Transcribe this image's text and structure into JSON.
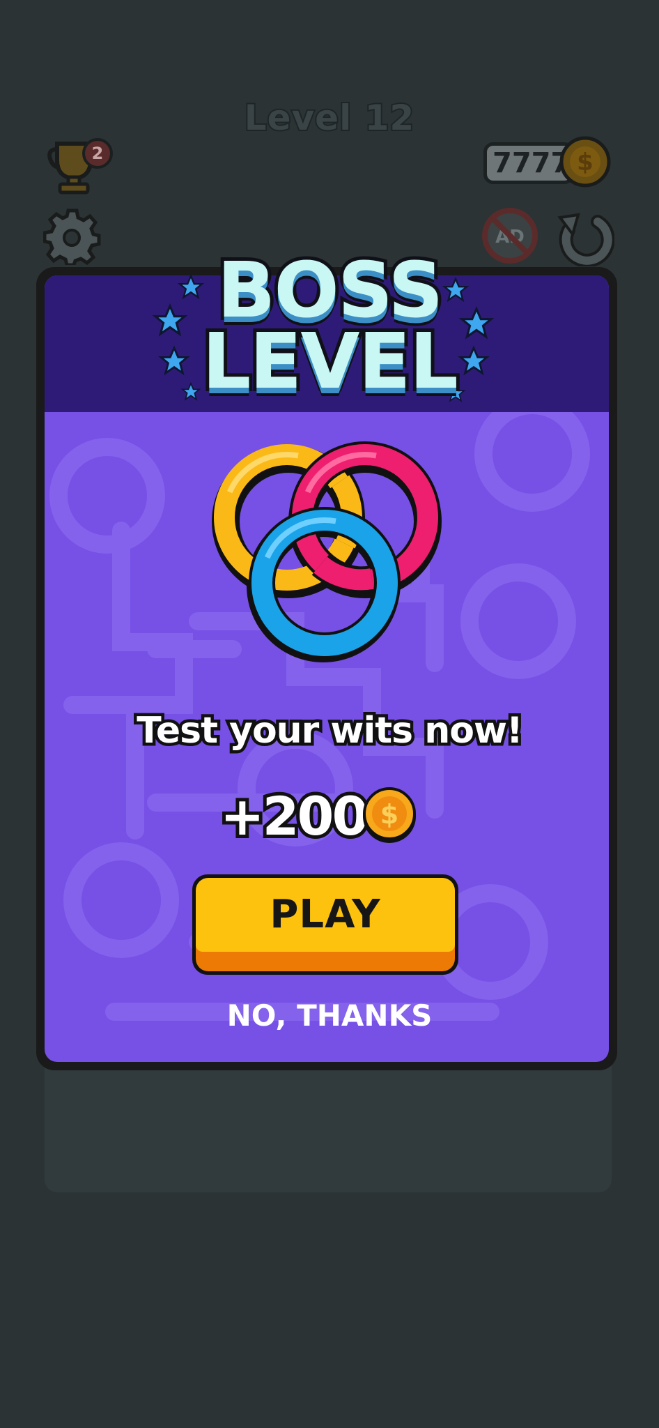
{
  "hud": {
    "level_title": "Level 12",
    "trophy_badge": "2",
    "coins": "7777",
    "coin_symbol": "$",
    "noad_label": "AD"
  },
  "modal": {
    "title_line1": "BOSS",
    "title_line2": "LEVEL",
    "tagline": "Test your wits now!",
    "reward_amount": "+200",
    "reward_coin_symbol": "$",
    "play_label": "PLAY",
    "dismiss_label": "NO, THANKS"
  },
  "colors": {
    "background": "#2b3335",
    "modal_header": "#2e1b78",
    "modal_body": "#7750e6",
    "title_fill": "#c9f7f3",
    "play_button": "#fcc20e",
    "play_button_shadow": "#ec7a04",
    "ring_yellow": "#fbb918",
    "ring_pink": "#ee1f6e",
    "ring_blue": "#1aa3e8"
  },
  "icons": [
    "trophy-icon",
    "coin-icon",
    "gear-icon",
    "no-ads-icon",
    "restart-icon",
    "star-icon",
    "rings-icon"
  ]
}
